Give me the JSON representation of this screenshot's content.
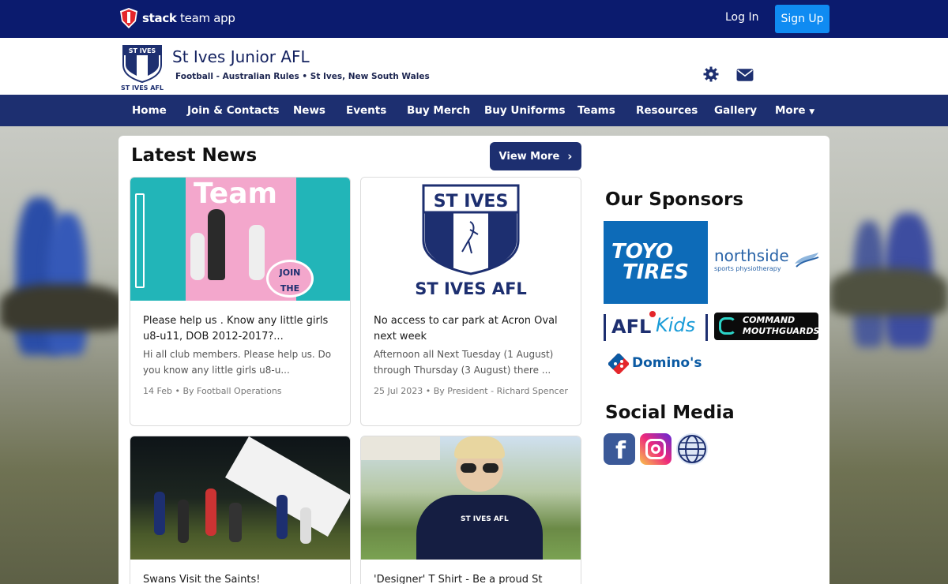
{
  "topbar": {
    "brand_bold": "stack",
    "brand_rest": " team app",
    "login": "Log In",
    "signup": "Sign Up"
  },
  "club": {
    "name": "St Ives Junior AFL",
    "subtitle": "Football - Australian Rules • St Ives, New South Wales",
    "logo_top": "ST IVES",
    "logo_bottom": "ST IVES AFL"
  },
  "nav": {
    "items": [
      "Home",
      "Join & Contacts",
      "News",
      "Events",
      "Buy Merch",
      "Buy Uniforms",
      "Teams",
      "Resources",
      "Gallery",
      "More"
    ]
  },
  "latest": {
    "title": "Latest News",
    "view_more": "View More"
  },
  "news": [
    {
      "title": "Please help us . Know any little girls u8-u11, DOB 2012-2017?...",
      "excerpt": "Hi all club members. Please help us. Do you know any little girls u8-u...",
      "meta": "14 Feb • By Football Operations",
      "thumb_text1": "Team",
      "thumb_text2": "JOIN THE TEAM!"
    },
    {
      "title": "No access to car park at Acron Oval next week",
      "excerpt": "Afternoon all Next Tuesday (1 August) through Thursday (3 August) there ...",
      "meta": "25 Jul 2023 • By President - Richard Spencer",
      "thumb_text1": "ST IVES",
      "thumb_text2": "ST IVES AFL"
    },
    {
      "title": "Swans Visit the Saints!",
      "excerpt": "",
      "meta": ""
    },
    {
      "title": "'Designer' T Shirt - Be a proud St",
      "excerpt": "",
      "meta": "",
      "thumb_text1": "ST IVES AFL"
    }
  ],
  "sponsors": {
    "title": "Our Sponsors",
    "toyo_line1": "TOYO",
    "toyo_line2": "TIRES",
    "northside_main": "northside",
    "northside_sub": "sports physiotherapy",
    "afl_a": "AFL",
    "afl_b": "Kids",
    "command_line1": "COMMAND",
    "command_line2": "MOUTHGUARDS",
    "dominos": "Domino's"
  },
  "social": {
    "title": "Social Media",
    "items": [
      "facebook-icon",
      "instagram-icon",
      "globe-icon"
    ]
  },
  "colors": {
    "topbar": "#0b1b6e",
    "nav": "#1d2f70",
    "signup": "#0f8bf2",
    "club_text": "#13215f"
  }
}
